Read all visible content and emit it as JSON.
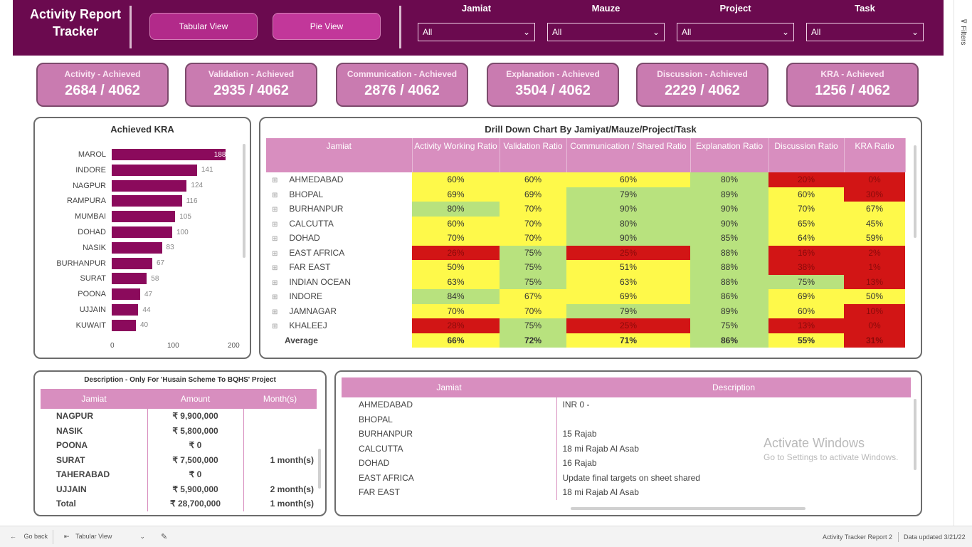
{
  "header": {
    "title_line1": "Activity Report",
    "title_line2": "Tracker",
    "buttons": [
      "Tabular View",
      "Pie View"
    ],
    "filters": [
      {
        "label": "Jamiat",
        "value": "All"
      },
      {
        "label": "Mauze",
        "value": "All"
      },
      {
        "label": "Project",
        "value": "All"
      },
      {
        "label": "Task",
        "value": "All"
      }
    ],
    "colors": {
      "header_bg": "#6b0a4f",
      "button_bg": "#b22a8a",
      "kpi_bg": "#c97bb0"
    }
  },
  "kpis": [
    {
      "title": "Activity - Achieved",
      "value": "2684 / 4062"
    },
    {
      "title": "Validation - Achieved",
      "value": "2935 / 4062"
    },
    {
      "title": "Communication - Achieved",
      "value": "2876 / 4062"
    },
    {
      "title": "Explanation - Achieved",
      "value": "3504 / 4062"
    },
    {
      "title": "Discussion - Achieved",
      "value": "2229 / 4062"
    },
    {
      "title": "KRA - Achieved",
      "value": "1256 / 4062"
    }
  ],
  "kra_chart": {
    "title": "Achieved KRA",
    "ticks": [
      "0",
      "100",
      "200"
    ]
  },
  "chart_data": {
    "type": "bar",
    "orientation": "horizontal",
    "title": "Achieved KRA",
    "categories": [
      "MAROL",
      "INDORE",
      "NAGPUR",
      "RAMPURA",
      "MUMBAI",
      "DOHAD",
      "NASIK",
      "BURHANPUR",
      "SURAT",
      "POONA",
      "UJJAIN",
      "KUWAIT"
    ],
    "values": [
      188,
      141,
      124,
      116,
      105,
      100,
      83,
      67,
      58,
      47,
      44,
      40
    ],
    "xlim": [
      0,
      200
    ],
    "bar_color": "#8b0a5c"
  },
  "drill": {
    "title": "Drill Down Chart By Jamiyat/Mauze/Project/Task",
    "columns": [
      "Jamiat",
      "Activity Working Ratio",
      "Validation Ratio",
      "Communication / Shared Ratio",
      "Explanation Ratio",
      "Discussion Ratio",
      "KRA Ratio"
    ],
    "rows": [
      {
        "name": "AHMEDABAD",
        "cells": [
          [
            "60%",
            "y"
          ],
          [
            "60%",
            "y"
          ],
          [
            "60%",
            "y"
          ],
          [
            "80%",
            "g"
          ],
          [
            "20%",
            "r"
          ],
          [
            "0%",
            "r"
          ]
        ]
      },
      {
        "name": "BHOPAL",
        "cells": [
          [
            "69%",
            "y"
          ],
          [
            "69%",
            "y"
          ],
          [
            "79%",
            "g"
          ],
          [
            "89%",
            "g"
          ],
          [
            "60%",
            "y"
          ],
          [
            "30%",
            "r"
          ]
        ]
      },
      {
        "name": "BURHANPUR",
        "cells": [
          [
            "80%",
            "g"
          ],
          [
            "70%",
            "y"
          ],
          [
            "90%",
            "g"
          ],
          [
            "90%",
            "g"
          ],
          [
            "70%",
            "y"
          ],
          [
            "67%",
            "y"
          ]
        ]
      },
      {
        "name": "CALCUTTA",
        "cells": [
          [
            "60%",
            "y"
          ],
          [
            "70%",
            "y"
          ],
          [
            "80%",
            "g"
          ],
          [
            "90%",
            "g"
          ],
          [
            "65%",
            "y"
          ],
          [
            "45%",
            "y"
          ]
        ]
      },
      {
        "name": "DOHAD",
        "cells": [
          [
            "70%",
            "y"
          ],
          [
            "70%",
            "y"
          ],
          [
            "90%",
            "g"
          ],
          [
            "85%",
            "g"
          ],
          [
            "64%",
            "y"
          ],
          [
            "59%",
            "y"
          ]
        ]
      },
      {
        "name": "EAST AFRICA",
        "cells": [
          [
            "26%",
            "r"
          ],
          [
            "75%",
            "g"
          ],
          [
            "25%",
            "r"
          ],
          [
            "88%",
            "g"
          ],
          [
            "16%",
            "r"
          ],
          [
            "2%",
            "r"
          ]
        ]
      },
      {
        "name": "FAR EAST",
        "cells": [
          [
            "50%",
            "y"
          ],
          [
            "75%",
            "g"
          ],
          [
            "51%",
            "y"
          ],
          [
            "88%",
            "g"
          ],
          [
            "38%",
            "r"
          ],
          [
            "1%",
            "r"
          ]
        ]
      },
      {
        "name": "INDIAN OCEAN",
        "cells": [
          [
            "63%",
            "y"
          ],
          [
            "75%",
            "g"
          ],
          [
            "63%",
            "y"
          ],
          [
            "88%",
            "g"
          ],
          [
            "75%",
            "g"
          ],
          [
            "13%",
            "r"
          ]
        ]
      },
      {
        "name": "INDORE",
        "cells": [
          [
            "84%",
            "g"
          ],
          [
            "67%",
            "y"
          ],
          [
            "69%",
            "y"
          ],
          [
            "86%",
            "g"
          ],
          [
            "69%",
            "y"
          ],
          [
            "50%",
            "y"
          ]
        ]
      },
      {
        "name": "JAMNAGAR",
        "cells": [
          [
            "70%",
            "y"
          ],
          [
            "70%",
            "y"
          ],
          [
            "79%",
            "g"
          ],
          [
            "89%",
            "g"
          ],
          [
            "60%",
            "y"
          ],
          [
            "10%",
            "r"
          ]
        ]
      },
      {
        "name": "KHALEEJ",
        "cells": [
          [
            "28%",
            "r"
          ],
          [
            "75%",
            "g"
          ],
          [
            "25%",
            "r"
          ],
          [
            "75%",
            "g"
          ],
          [
            "13%",
            "r"
          ],
          [
            "0%",
            "r"
          ]
        ]
      }
    ],
    "average": {
      "label": "Average",
      "cells": [
        [
          "66%",
          "y"
        ],
        [
          "72%",
          "g"
        ],
        [
          "71%",
          "y"
        ],
        [
          "86%",
          "g"
        ],
        [
          "55%",
          "y"
        ],
        [
          "31%",
          "r"
        ]
      ]
    }
  },
  "project_table": {
    "title": "Description - Only For 'Husain Scheme To BQHS' Project",
    "columns": [
      "Jamiat",
      "Amount",
      "Month(s)"
    ],
    "rows": [
      {
        "name": "NAGPUR",
        "amount": "₹ 9,900,000",
        "months": ""
      },
      {
        "name": "NASIK",
        "amount": "₹ 5,800,000",
        "months": ""
      },
      {
        "name": "POONA",
        "amount": "₹ 0",
        "months": ""
      },
      {
        "name": "SURAT",
        "amount": "₹ 7,500,000",
        "months": "1 month(s)"
      },
      {
        "name": "TAHERABAD",
        "amount": "₹ 0",
        "months": ""
      },
      {
        "name": "UJJAIN",
        "amount": "₹ 5,900,000",
        "months": "2 month(s)"
      }
    ],
    "total": {
      "name": "Total",
      "amount": "₹ 28,700,000",
      "months": "1 month(s)"
    }
  },
  "desc_table": {
    "columns": [
      "Jamiat",
      "Description"
    ],
    "rows": [
      {
        "name": "AHMEDABAD",
        "desc": "INR 0 -"
      },
      {
        "name": "BHOPAL",
        "desc": ""
      },
      {
        "name": "BURHANPUR",
        "desc": "15 Rajab"
      },
      {
        "name": "CALCUTTA",
        "desc": "18 mi Rajab Al Asab"
      },
      {
        "name": "DOHAD",
        "desc": "16 Rajab"
      },
      {
        "name": "EAST AFRICA",
        "desc": "Update final targets on sheet shared"
      },
      {
        "name": "FAR EAST",
        "desc": "18 mi Rajab Al Asab"
      }
    ]
  },
  "watermark": {
    "line1": "Activate Windows",
    "line2": "Go to Settings to activate Windows."
  },
  "bottom": {
    "back": "Go back",
    "page": "Tabular View",
    "report_name": "Activity Tracker Report 2",
    "updated": "Data updated 3/21/22",
    "filters_label": "Filters"
  }
}
